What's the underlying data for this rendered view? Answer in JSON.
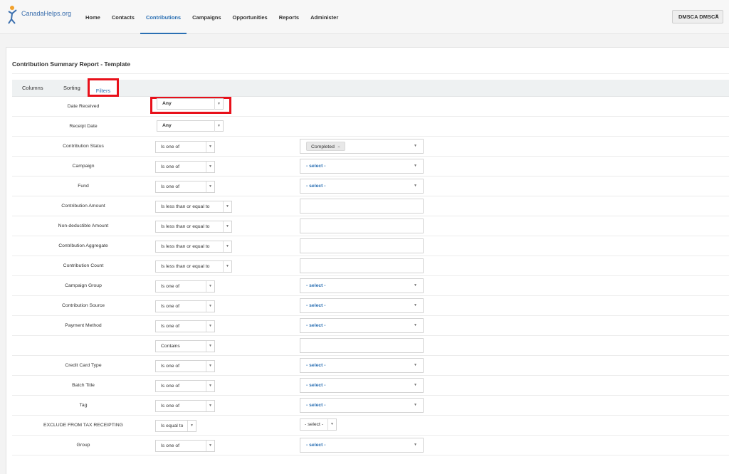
{
  "brand": {
    "logo_text": "CanadaHelps.org"
  },
  "nav": [
    {
      "label": "Home"
    },
    {
      "label": "Contacts"
    },
    {
      "label": "Contributions"
    },
    {
      "label": "Campaigns"
    },
    {
      "label": "Opportunities"
    },
    {
      "label": "Reports"
    },
    {
      "label": "Administer"
    }
  ],
  "user": {
    "label": "DMSCA DMSCA"
  },
  "report": {
    "title": "Contribution Summary Report - Template"
  },
  "tabs": [
    {
      "label": "Columns"
    },
    {
      "label": "Sorting"
    },
    {
      "label": "Filters"
    }
  ],
  "filters": [
    {
      "label": "Date Received",
      "operator": "Any"
    },
    {
      "label": "Receipt Date",
      "operator": "Any"
    },
    {
      "label": "Contribution Status",
      "operator": "Is one of",
      "value": "Completed"
    },
    {
      "label": "Campaign",
      "operator": "Is one of",
      "value": "- select -"
    },
    {
      "label": "Fund",
      "operator": "Is one of",
      "value": "- select -"
    },
    {
      "label": "Contribution Amount",
      "operator": "Is less than or equal to",
      "value": ""
    },
    {
      "label": "Non-deductible Amount",
      "operator": "Is less than or equal to",
      "value": ""
    },
    {
      "label": "Contribution Aggregate",
      "operator": "Is less than or equal to",
      "value": ""
    },
    {
      "label": "Contribution Count",
      "operator": "Is less than or equal to",
      "value": ""
    },
    {
      "label": "Campaign Group",
      "operator": "Is one of",
      "value": "- select -"
    },
    {
      "label": "Contribution Source",
      "operator": "Is one of",
      "value": "- select -"
    },
    {
      "label": "Payment Method",
      "operator": "Is one of",
      "value": "- select -"
    },
    {
      "label": "",
      "operator": "Contains",
      "value": ""
    },
    {
      "label": "Credit Card Type",
      "operator": "Is one of",
      "value": "- select -"
    },
    {
      "label": "Batch Title",
      "operator": "Is one of",
      "value": "- select -"
    },
    {
      "label": "Tag",
      "operator": "Is one of",
      "value": "- select -"
    },
    {
      "label": "EXCLUDE FROM TAX RECEIPTING",
      "operator": "Is equal to",
      "value": "- select -"
    },
    {
      "label": "Group",
      "operator": "Is one of",
      "value": "- select -"
    }
  ],
  "colors": {
    "accent": "#2a6fb3",
    "highlight_box": "#e8101a"
  }
}
